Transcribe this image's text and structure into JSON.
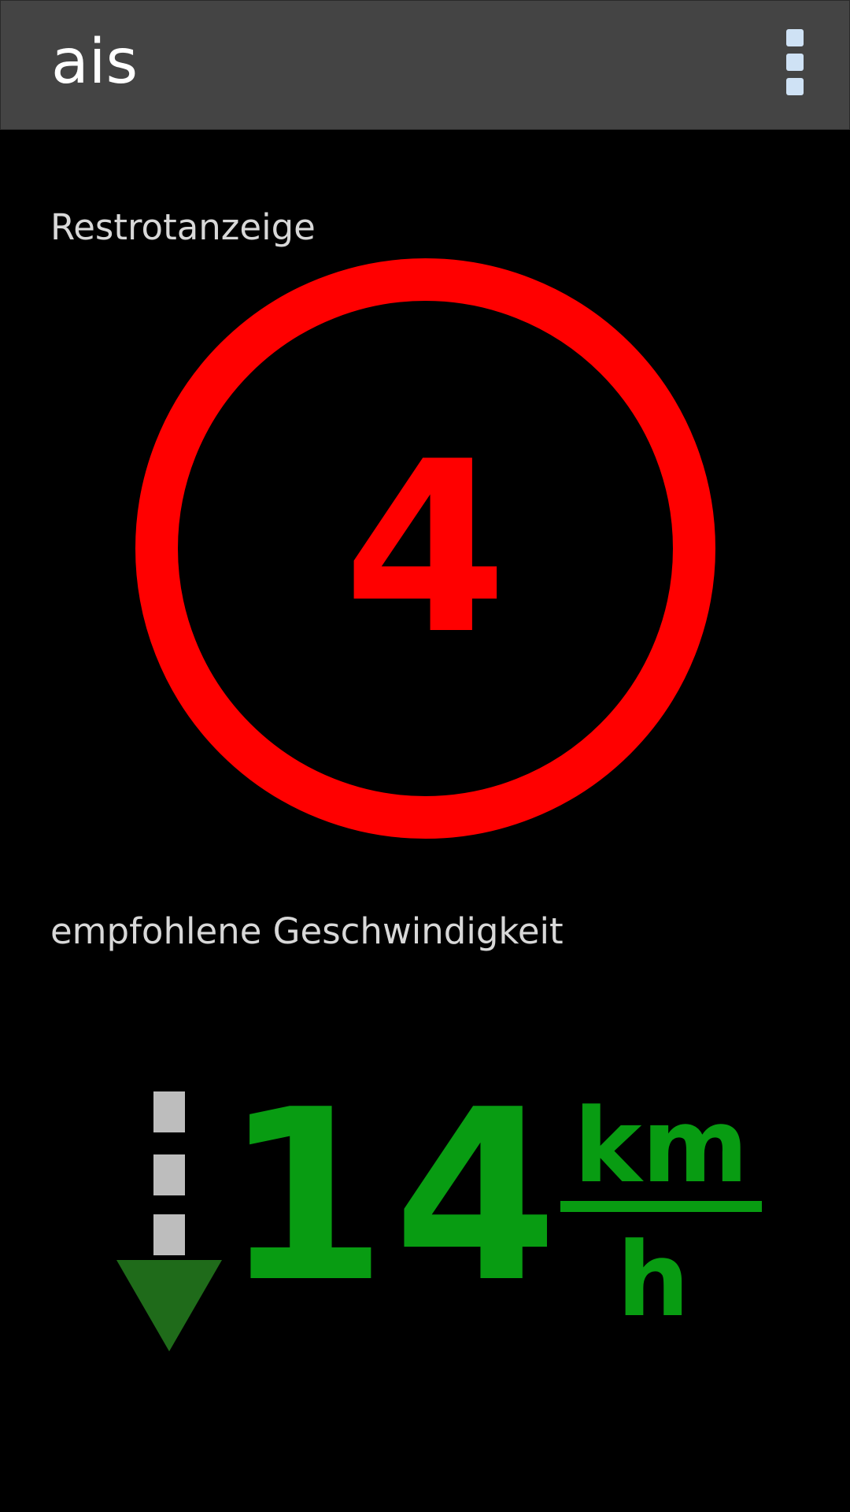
{
  "app": {
    "title": "ais",
    "menu_icon": "overflow-menu-icon"
  },
  "countdown": {
    "label": "Restrotanzeige",
    "value": "4",
    "color": "#ff0000"
  },
  "speed": {
    "label": "empfohlene Geschwindigkeit",
    "value": "14",
    "unit_numerator": "km",
    "unit_denominator": "h",
    "color": "#089c12",
    "trend_icon": "speed-down-arrow-icon"
  },
  "colors": {
    "background": "#000000",
    "action_bar": "#444444"
  }
}
